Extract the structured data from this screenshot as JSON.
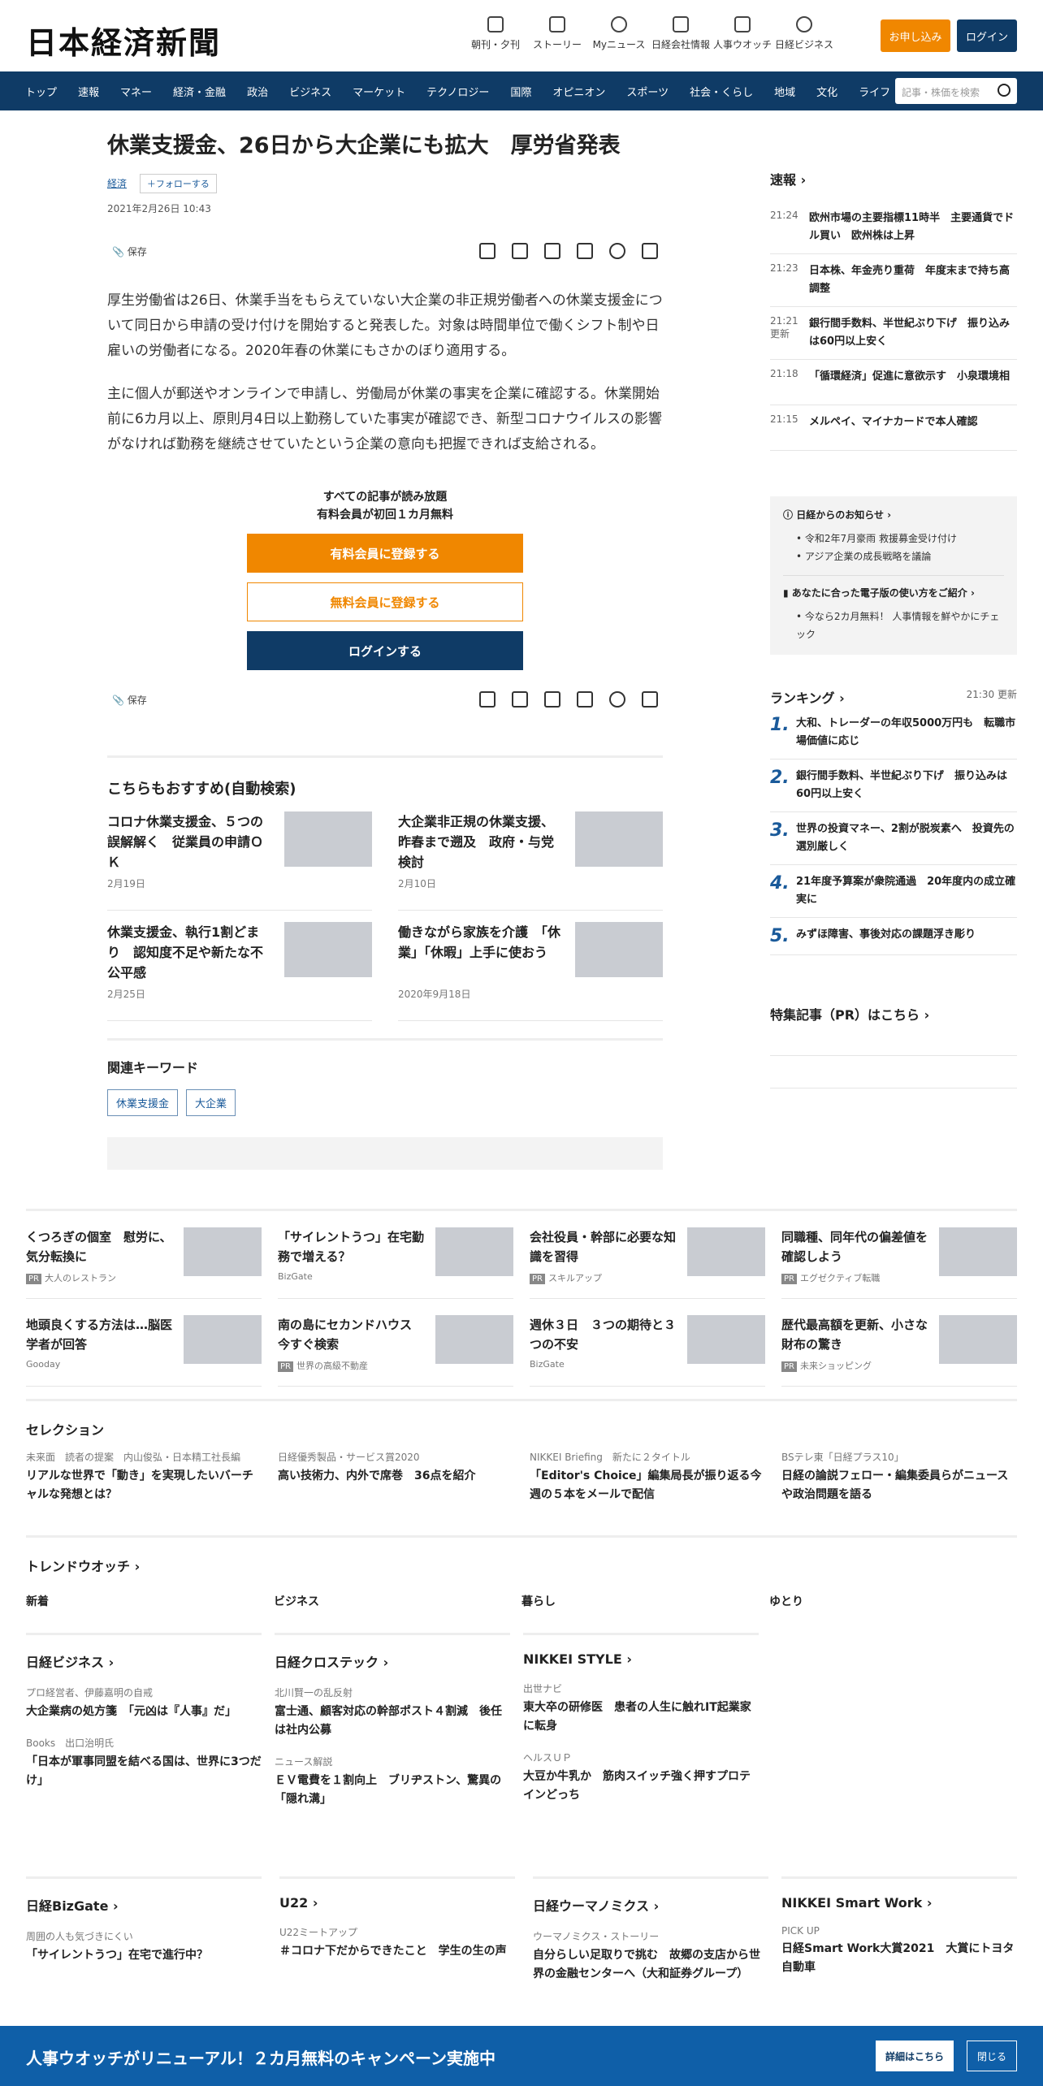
{
  "header": {
    "logo": "日本経済新聞",
    "nav": [
      {
        "label": "朝刊・夕刊"
      },
      {
        "label": "ストーリー"
      },
      {
        "label": "Myニュース"
      },
      {
        "label": "日経会社情報"
      },
      {
        "label": "人事ウオッチ"
      },
      {
        "label": "日経ビジネス"
      }
    ],
    "subscribe": "お申し込み",
    "login": "ログイン"
  },
  "gnav": {
    "items": [
      "トップ",
      "速報",
      "マネー",
      "経済・金融",
      "政治",
      "ビジネス",
      "マーケット",
      "テクノロジー",
      "国際",
      "オピニオン",
      "スポーツ",
      "社会・くらし",
      "地域",
      "文化",
      "ライフ"
    ],
    "search_placeholder": "記事・株価を検索"
  },
  "article": {
    "title": "休業支援金、26日から大企業にも拡大　厚労省発表",
    "category": "経済",
    "follow": "＋フォローする",
    "date": "2021年2月26日 10:43",
    "save": "保存",
    "p1": "厚生労働省は26日、休業手当をもらえていない大企業の非正規労働者への休業支援金について同日から申請の受け付けを開始すると発表した。対象は時間単位で働くシフト制や日雇いの労働者になる。2020年春の休業にもさかのぼり適用する。",
    "p2": "主に個人が郵送やオンラインで申請し、労働局が休業の事実を企業に確認する。休業開始前に6カ月以上、原則月4日以上勤務していた事実が確認でき、新型コロナウイルスの影響がなければ勤務を継続させていたという企業の意向も把握できれば支給される。"
  },
  "paywall": {
    "line1": "すべての記事が読み放題",
    "line2": "有料会員が初回１カ月無料",
    "paid": "有料会員に登録する",
    "free": "無料会員に登録する",
    "login": "ログインする"
  },
  "recommend": {
    "title": "こちらもおすすめ(自動検索)",
    "items": [
      {
        "title": "コロナ休業支援金、５つの誤解解く　従業員の申請ＯＫ",
        "date": "2月19日"
      },
      {
        "title": "大企業非正規の休業支援、昨春まで遡及　政府・与党検討",
        "date": "2月10日"
      },
      {
        "title": "休業支援金、執行1割どまり　認知度不足や新たな不公平感",
        "date": "2月25日"
      },
      {
        "title": "働きながら家族を介護　「休業」「休暇」上手に使おう",
        "date": "2020年9月18日"
      }
    ]
  },
  "keywords": {
    "title": "関連キーワード",
    "tags": [
      "休業支援金",
      "大企業"
    ]
  },
  "side": {
    "flash_title": "速報",
    "flash": [
      {
        "time": "21:24",
        "text": "欧州市場の主要指標11時半　主要通貨でドル買い　欧州株は上昇"
      },
      {
        "time": "21:23",
        "text": "日本株、年金売り重荷　年度末まで持ち高調整"
      },
      {
        "time": "21:21 更新",
        "text": "銀行間手数料、半世紀ぶり下げ　振り込みは60円以上安く"
      },
      {
        "time": "21:18",
        "text": "「循環経済」促進に意欲示す　小泉環境相"
      },
      {
        "time": "21:15",
        "text": "メルペイ、マイナカードで本人確認"
      }
    ],
    "notice_title": "日経からのお知らせ",
    "notice": [
      "令和2年7月豪雨 救援募金受け付け",
      "アジア企業の成長戦略を議論"
    ],
    "guide_title": "あなたに合った電子版の使い方をご紹介",
    "guide": [
      "今なら2カ月無料！ 人事情報を鮮やかにチェック"
    ],
    "rank_title": "ランキング",
    "rank_updated": "21:30 更新",
    "rank": [
      {
        "n": "1.",
        "text": "大和、トレーダーの年収5000万円も　転職市場価値に応じ"
      },
      {
        "n": "2.",
        "text": "銀行間手数料、半世紀ぶり下げ　振り込みは60円以上安く"
      },
      {
        "n": "3.",
        "text": "世界の投資マネー、2割が脱炭素へ　投資先の選別厳しく"
      },
      {
        "n": "4.",
        "text": "21年度予算案が衆院通過　20年度内の成立確実に"
      },
      {
        "n": "5.",
        "text": "みずほ障害、事後対応の課題浮き彫り"
      }
    ],
    "pr_title": "特集記事（PR）はこちら"
  },
  "ads": [
    {
      "title": "くつろぎの個室　慰労に、気分転換に",
      "sponsor": "大人のレストラン",
      "pr": "PR"
    },
    {
      "title": "「サイレントうつ」在宅勤務で増える？",
      "sponsor": "BizGate",
      "pr": ""
    },
    {
      "title": "会社役員・幹部に必要な知識を習得",
      "sponsor": "スキルアップ",
      "pr": "PR"
    },
    {
      "title": "同職種、同年代の偏差値を確認しよう",
      "sponsor": "エグゼクティブ転職",
      "pr": "PR"
    },
    {
      "title": "地頭良くする方法は…脳医学者が回答",
      "sponsor": "Gooday",
      "pr": ""
    },
    {
      "title": "南の島にセカンドハウス　今すぐ検索",
      "sponsor": "世界の高級不動産",
      "pr": "PR"
    },
    {
      "title": "週休３日　３つの期待と３つの不安",
      "sponsor": "BizGate",
      "pr": ""
    },
    {
      "title": "歴代最高額を更新、小さな財布の驚き",
      "sponsor": "未来ショッピング",
      "pr": "PR"
    }
  ],
  "selection": {
    "title": "セレクション",
    "items": [
      {
        "sub": "未来面　読者の提案　内山俊弘・日本精工社長編",
        "title": "リアルな世界で「動き」を実現したいバーチャルな発想とは？"
      },
      {
        "sub": "日経優秀製品・サービス賞2020",
        "title": "高い技術力、内外で席巻　36点を紹介"
      },
      {
        "sub": "NIKKEI Briefing　新たに２タイトル",
        "title": "「Editor's Choice」編集局長が振り返る今週の５本をメールで配信"
      },
      {
        "sub": "BSテレ東「日経プラス10」",
        "title": "日経の論説フェロー・編集委員らがニュースや政治問題を語る"
      }
    ]
  },
  "trend": {
    "title": "トレンドウオッチ",
    "cats": [
      "新着",
      "ビジネス",
      "暮らし",
      "ゆとり"
    ]
  },
  "blocks": [
    {
      "head": "日経ビジネス",
      "entries": [
        {
          "sub": "プロ経営者、伊藤嘉明の自戒",
          "title": "大企業病の処方箋　「元凶は『人事』だ」"
        },
        {
          "sub": "Books　出口治明氏",
          "title": "「日本が軍事同盟を結べる国は、世界に3つだけ」"
        }
      ]
    },
    {
      "head": "日経クロステック",
      "entries": [
        {
          "sub": "北川賢一の乱反射",
          "title": "富士通、顧客対応の幹部ポスト４割減　後任は社内公募"
        },
        {
          "sub": "ニュース解説",
          "title": "ＥＶ電費を１割向上　ブリヂストン、驚異の「隠れ溝」"
        }
      ]
    },
    {
      "head": "NIKKEI STYLE",
      "entries": [
        {
          "sub": "出世ナビ",
          "title": "東大卒の研修医　患者の人生に触れIT起業家に転身"
        },
        {
          "sub": "ヘルスＵＰ",
          "title": "大豆か牛乳か　筋肉スイッチ強く押すプロテインどっち"
        }
      ]
    },
    {
      "head": "日経BizGate",
      "entries": [
        {
          "sub": "周囲の人も気づきにくい",
          "title": "「サイレントうつ」在宅で進行中？"
        }
      ]
    },
    {
      "head": "U22",
      "entries": [
        {
          "sub": "U22ミートアップ",
          "title": "＃コロナ下だからできたこと　学生の生の声"
        }
      ]
    },
    {
      "head": "日経ウーマノミクス",
      "entries": [
        {
          "sub": "ウーマノミクス・ストーリー",
          "title": "自分らしい足取りで挑む　故郷の支店から世界の金融センターへ（大和証券グループ）"
        }
      ]
    },
    {
      "head": "NIKKEI Smart Work",
      "entries": [
        {
          "sub": "PICK UP",
          "title": "日経Smart Work大賞2021　大賞にトヨタ自動車"
        }
      ]
    }
  ],
  "banner": {
    "text": "人事ウオッチがリニューアル！２カ月無料のキャンペーン実施中",
    "detail": "詳細はこちら",
    "close": "閉じる"
  }
}
